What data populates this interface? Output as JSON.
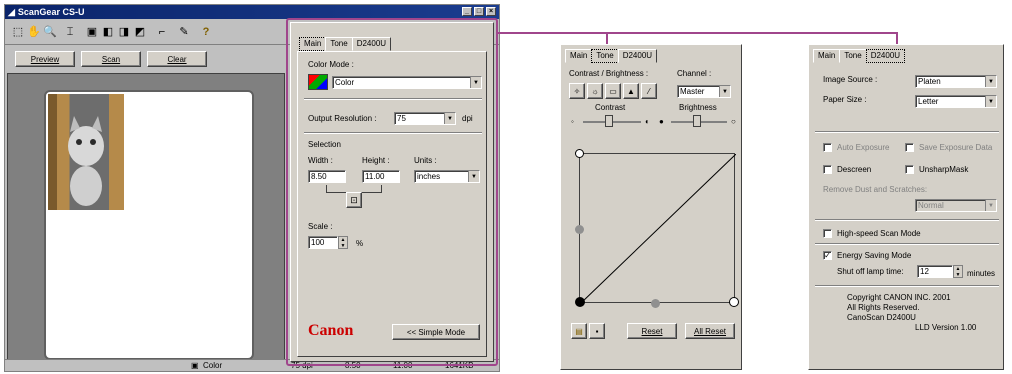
{
  "window": {
    "title": "ScanGear CS-U",
    "preview_button": "Preview",
    "scan_button": "Scan",
    "clear_button": "Clear",
    "status": {
      "mode": "Color",
      "dpi": "75 dpi",
      "w": "8.50",
      "h": "11.00",
      "size": "1641KB"
    }
  },
  "main_tab": {
    "tabs": [
      "Main",
      "Tone",
      "D2400U"
    ],
    "color_mode_label": "Color Mode :",
    "color_mode_value": "Color",
    "resolution_label": "Output Resolution :",
    "resolution_value": "75",
    "resolution_unit": "dpi",
    "selection_label": "Selection",
    "width_label": "Width :",
    "height_label": "Height :",
    "units_label": "Units :",
    "width_value": "8.50",
    "height_value": "11.00",
    "units_value": "inches",
    "scale_label": "Scale :",
    "scale_value": "100",
    "scale_unit": "%",
    "brand": "Canon",
    "simple_mode_button": "<< Simple Mode"
  },
  "tone_tab": {
    "tabs": [
      "Main",
      "Tone",
      "D2400U"
    ],
    "contrast_brightness_label": "Contrast / Brightness :",
    "channel_label": "Channel :",
    "channel_value": "Master",
    "contrast_label": "Contrast",
    "brightness_label": "Brightness",
    "reset_button": "Reset",
    "all_reset_button": "All Reset"
  },
  "d2400u_tab": {
    "tabs": [
      "Main",
      "Tone",
      "D2400U"
    ],
    "image_source_label": "Image Source :",
    "image_source_value": "Platen",
    "paper_size_label": "Paper Size :",
    "paper_size_value": "Letter",
    "auto_exposure": "Auto Exposure",
    "save_exposure": "Save Exposure Data",
    "descreen": "Descreen",
    "unsharp": "UnsharpMask",
    "remove_dust_label": "Remove Dust and Scratches:",
    "remove_dust_value": "Normal",
    "high_speed": "High-speed Scan Mode",
    "energy_saving": "Energy Saving Mode",
    "shutoff_label": "Shut off lamp time:",
    "shutoff_value": "12",
    "shutoff_unit": "minutes",
    "copyright1": "Copyright CANON INC. 2001",
    "copyright2": "All Rights Reserved.",
    "model": "CanoScan D2400U",
    "version": "LLD  Version  1.00"
  },
  "colors": {
    "highlight": "#a0468c",
    "connector": "#a0468c",
    "brand_red": "#cc0000"
  }
}
